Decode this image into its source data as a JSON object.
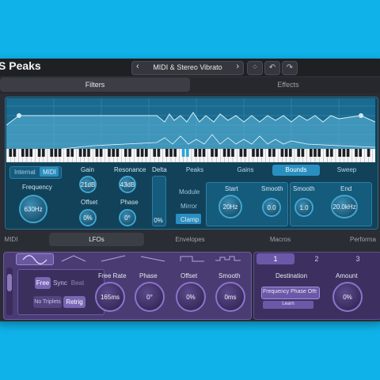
{
  "app": {
    "title": "S Peaks"
  },
  "preset": {
    "name": "MIDI & Stereo Vibrato",
    "prev": "‹",
    "next": "›"
  },
  "toolbar": {
    "random_icon": "⁘",
    "undo_icon": "↶",
    "redo_icon": "↷"
  },
  "main_tabs": [
    {
      "label": "Filters",
      "active": true
    },
    {
      "label": "Effects",
      "active": false
    }
  ],
  "filters": {
    "mode": {
      "internal": "Internal",
      "midi": "MIDI",
      "active": "MIDI"
    },
    "frequency": {
      "label": "Frequency",
      "value": "630Hz"
    },
    "gain": {
      "label": "Gain",
      "value": "21dB"
    },
    "resonance": {
      "label": "Resonance",
      "value": "43dB"
    },
    "offset": {
      "label": "Offset",
      "value": "0%"
    },
    "phase": {
      "label": "Phase",
      "value": "0°"
    },
    "delta": {
      "label": "Delta",
      "value": "0%"
    },
    "subtabs": [
      "Peaks",
      "Gains",
      "Bounds",
      "Sweep"
    ],
    "active_subtab": "Bounds",
    "module": {
      "label": "Module",
      "mirror": "Mirror",
      "clamp": "Clamp"
    },
    "start": {
      "label": "Start",
      "value": "20Hz"
    },
    "smooth_a": {
      "label": "Smooth",
      "value": "0.0"
    },
    "smooth_b": {
      "label": "Smooth",
      "value": "1.0"
    },
    "end": {
      "label": "End",
      "value": "20.0kHz"
    }
  },
  "bottom_tabs": [
    "MIDI",
    "LFOs",
    "Envelopes",
    "Macros",
    "Performa"
  ],
  "active_bottom_tab": "LFOs",
  "lfo": {
    "shapes": [
      "sine",
      "triangle",
      "saw",
      "ramp",
      "square",
      "steps"
    ],
    "sync": {
      "free": "Free",
      "sync": "Sync",
      "beat": "Beat"
    },
    "no_triplets": "No Triplets",
    "retrig": "Retrig",
    "free_rate": {
      "label": "Free Rate",
      "value": "165ms"
    },
    "phase": {
      "label": "Phase",
      "value": "0°"
    },
    "offset": {
      "label": "Offset",
      "value": "0%"
    },
    "smooth": {
      "label": "Smooth",
      "value": "0ms"
    }
  },
  "mod": {
    "tabs": [
      "1",
      "2",
      "3"
    ],
    "destination": {
      "label": "Destination",
      "value": "Frequency Phase Offset",
      "learn": "Learn"
    },
    "amount": {
      "label": "Amount",
      "value": "0%"
    }
  },
  "colors": {
    "background": "#0fb3ea",
    "filter_panel": "#11425a",
    "accent_blue": "#2a8fc0",
    "lfo_panel": "#4a3b73",
    "accent_purple": "#7a66b5"
  }
}
